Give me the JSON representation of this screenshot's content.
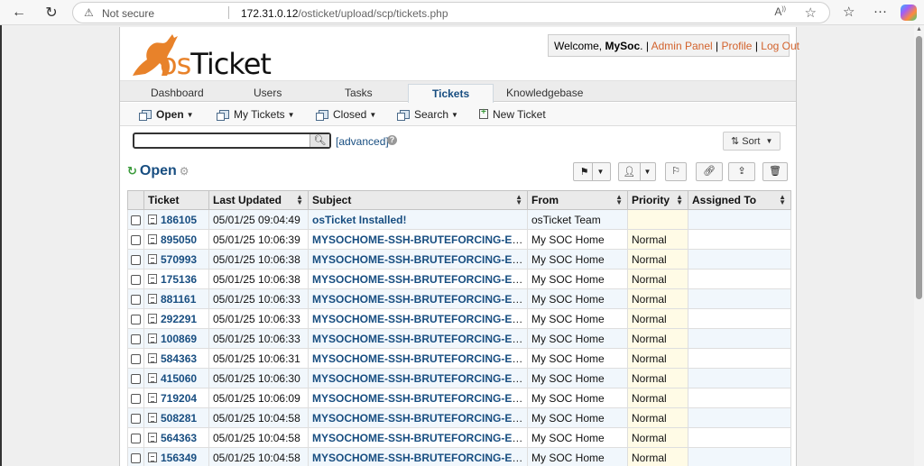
{
  "browser": {
    "not_secure": "Not secure",
    "url_host": "172.31.0.12",
    "url_path": "/osticket/upload/scp/tickets.php"
  },
  "header": {
    "logo_prefix": "os",
    "logo_suffix": "Ticket",
    "welcome_prefix": "Welcome, ",
    "username": "MySoc",
    "admin_panel": "Admin Panel",
    "profile": "Profile",
    "logout": "Log Out"
  },
  "tabs": [
    {
      "label": "Dashboard"
    },
    {
      "label": "Users"
    },
    {
      "label": "Tasks"
    },
    {
      "label": "Tickets"
    },
    {
      "label": "Knowledgebase"
    }
  ],
  "subnav": {
    "open": "Open",
    "my_tickets": "My Tickets",
    "closed": "Closed",
    "search": "Search",
    "new_ticket": "New Ticket"
  },
  "search": {
    "advanced": "[advanced]",
    "sort": "Sort"
  },
  "queue": {
    "title": "Open"
  },
  "table": {
    "headers": [
      "Ticket",
      "Last Updated",
      "Subject",
      "From",
      "Priority",
      "Assigned To"
    ],
    "rows": [
      {
        "ticket": "186105",
        "updated": "05/01/25 09:04:49",
        "subject": "osTicket Installed!",
        "from": "osTicket Team",
        "priority": "",
        "assigned": ""
      },
      {
        "ticket": "895050",
        "updated": "05/01/25 10:06:39",
        "subject": "MYSOCHOME-SSH-BRUTEFORCING-EVE...",
        "from": "My SOC Home",
        "priority": "Normal",
        "assigned": ""
      },
      {
        "ticket": "570993",
        "updated": "05/01/25 10:06:38",
        "subject": "MYSOCHOME-SSH-BRUTEFORCING-EVE...",
        "from": "My SOC Home",
        "priority": "Normal",
        "assigned": ""
      },
      {
        "ticket": "175136",
        "updated": "05/01/25 10:06:38",
        "subject": "MYSOCHOME-SSH-BRUTEFORCING-EVE...",
        "from": "My SOC Home",
        "priority": "Normal",
        "assigned": ""
      },
      {
        "ticket": "881161",
        "updated": "05/01/25 10:06:33",
        "subject": "MYSOCHOME-SSH-BRUTEFORCING-EVE...",
        "from": "My SOC Home",
        "priority": "Normal",
        "assigned": ""
      },
      {
        "ticket": "292291",
        "updated": "05/01/25 10:06:33",
        "subject": "MYSOCHOME-SSH-BRUTEFORCING-EVE...",
        "from": "My SOC Home",
        "priority": "Normal",
        "assigned": ""
      },
      {
        "ticket": "100869",
        "updated": "05/01/25 10:06:33",
        "subject": "MYSOCHOME-SSH-BRUTEFORCING-EVE...",
        "from": "My SOC Home",
        "priority": "Normal",
        "assigned": ""
      },
      {
        "ticket": "584363",
        "updated": "05/01/25 10:06:31",
        "subject": "MYSOCHOME-SSH-BRUTEFORCING-EVE...",
        "from": "My SOC Home",
        "priority": "Normal",
        "assigned": ""
      },
      {
        "ticket": "415060",
        "updated": "05/01/25 10:06:30",
        "subject": "MYSOCHOME-SSH-BRUTEFORCING-EVE...",
        "from": "My SOC Home",
        "priority": "Normal",
        "assigned": ""
      },
      {
        "ticket": "719204",
        "updated": "05/01/25 10:06:09",
        "subject": "MYSOCHOME-SSH-BRUTEFORCING-EVE...",
        "from": "My SOC Home",
        "priority": "Normal",
        "assigned": ""
      },
      {
        "ticket": "508281",
        "updated": "05/01/25 10:04:58",
        "subject": "MYSOCHOME-SSH-BRUTEFORCING-EVE...",
        "from": "My SOC Home",
        "priority": "Normal",
        "assigned": ""
      },
      {
        "ticket": "564363",
        "updated": "05/01/25 10:04:58",
        "subject": "MYSOCHOME-SSH-BRUTEFORCING-EVE...",
        "from": "My SOC Home",
        "priority": "Normal",
        "assigned": ""
      },
      {
        "ticket": "156349",
        "updated": "05/01/25 10:04:58",
        "subject": "MYSOCHOME-SSH-BRUTEFORCING-EVE...",
        "from": "My SOC Home",
        "priority": "Normal",
        "assigned": ""
      }
    ]
  },
  "colors": {
    "brand_orange": "#e8822a",
    "link_blue": "#184e81",
    "link_orange": "#d2622c"
  }
}
